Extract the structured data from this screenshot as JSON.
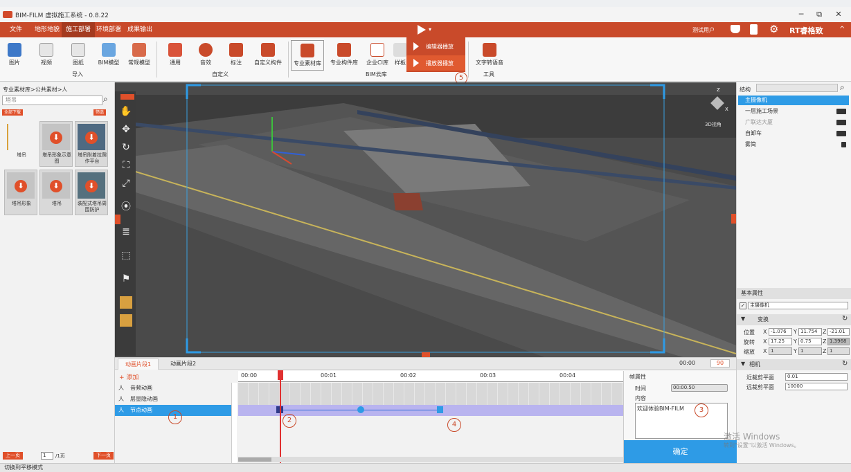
{
  "app": {
    "title": "BIM-FILM 虚拟施工系统 - 0.8.22"
  },
  "window_controls": {
    "minimize": "─",
    "restore": "⧉",
    "close": "✕"
  },
  "menu": {
    "tabs": [
      "文件",
      "地形地貌",
      "施工部署",
      "环境部署",
      "成果输出"
    ],
    "user": "测试用户",
    "brand": "RT睿格致",
    "collapse": "^"
  },
  "ribbon": {
    "buttons": [
      "图片",
      "视频",
      "图纸",
      "BIM模型",
      "常规模型",
      "通用",
      "音效",
      "标注",
      "自定义构件",
      "专业素材库",
      "专业构件库",
      "企业CI库",
      "样板",
      "文字转语音"
    ],
    "groups": [
      "导入",
      "自定义",
      "BIM云库",
      "工具"
    ]
  },
  "play_popup": {
    "items": [
      "编辑器播放",
      "播放器播放"
    ],
    "marker": "5"
  },
  "left_panel": {
    "breadcrumb": "专业素材库>公共素材>人",
    "search_placeholder": "塔吊",
    "download_all": "全部下载",
    "filter": "筛选",
    "assets": [
      "塔吊",
      "塔吊形象示意图",
      "塔吊附着拉爬作平台",
      "塔吊形象",
      "塔吊",
      "装配式塔吊周围防护"
    ],
    "prev_page": "上一页",
    "page_value": "1",
    "page_total": "/1页",
    "next_page": "下一页"
  },
  "viewport": {
    "view_label": "3D视角",
    "axis_x": "X",
    "axis_y": "Y",
    "axis_z": "Z"
  },
  "right_panel": {
    "structure_label": "结构",
    "tree": [
      "主摄像机",
      "一层施工场景",
      "广联达大厦",
      "自卸车",
      "雾简"
    ],
    "basic_props": "基本属性",
    "object_name": "主摄像机",
    "transform": "变换",
    "position_label": "位置",
    "position": [
      "-1.076",
      "11.754",
      "-21.01"
    ],
    "rotation_label": "旋转",
    "rotation": [
      "17.25",
      "0.75",
      "1.3968"
    ],
    "scale_label": "缩放",
    "scale": [
      "1",
      "1",
      "1"
    ],
    "camera": "相机",
    "near_label": "近裁剪平面",
    "near": "0.01",
    "far_label": "远裁剪平面",
    "far": "10000"
  },
  "timeline": {
    "tabs": [
      "动画片段1",
      "动画片段2"
    ],
    "time_display": "00:00",
    "frame_display": "90",
    "add_label": "+ 添加",
    "tracks": [
      "音频动画",
      "层显隐动画",
      "节点动画"
    ],
    "ruler": [
      "00:00",
      "00:01",
      "00:02",
      "00:03",
      "00:04"
    ],
    "frame_props": "帧属性",
    "time_label": "时间",
    "time_value": "00:00.50",
    "content_label": "内容",
    "content_value": "欢迎体验BIM-FILM",
    "confirm": "确定",
    "markers": [
      "1",
      "2",
      "3",
      "4"
    ]
  },
  "watermark": {
    "line1": "激活 Windows",
    "line2": "转到\"设置\"以激活 Windows。"
  },
  "status": {
    "text": "切换到平移模式"
  }
}
